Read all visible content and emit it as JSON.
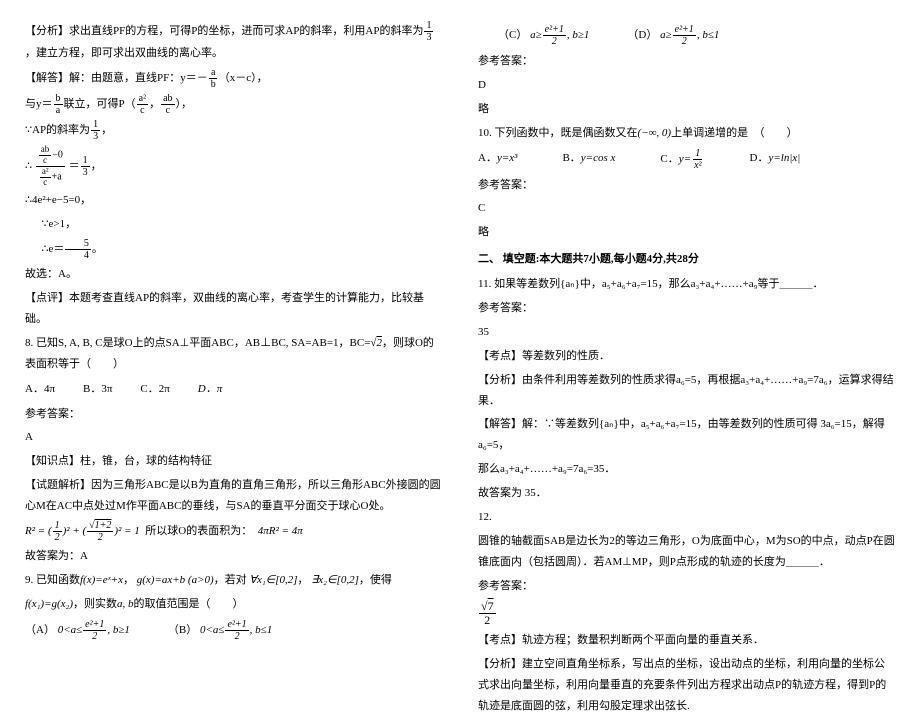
{
  "left": {
    "analysis1": "【分析】求出直线PF的方程，可得P的坐标，进而可求AP的斜率，利用AP的斜率为",
    "analysis1b": "，建立方程，即可求出双曲线的离心率。",
    "solve1": "【解答】解：由题意，直线PF：y＝－",
    "solve1b": "（x－c），",
    "line2a": "与y＝",
    "line2b": "联立，可得P（",
    "line2c": "，",
    "line2d": "），",
    "line3": "∵AP的斜率为",
    "line3b": "，",
    "line4a": "∴",
    "line4b": "＝",
    "line4c": "，",
    "line5": "∴4e²+e−5=0，",
    "line6": "∵e>1，",
    "line7a": "∴e＝",
    "line7b": "。",
    "line8": "故选：A。",
    "comment": "【点评】本题考查直线AP的斜率，双曲线的离心率，考查学生的计算能力，比较基础。",
    "q8": "8. 已知S, A, B, C是球O上的点SA⊥平面ABC，AB⊥BC, SA=AB=1，BC=",
    "q8b": "，则球O的表面积等于（　　）",
    "q8_optA": "A．4π",
    "q8_optB": "B．3π",
    "q8_optC": "C．2π",
    "q8_optD": "D．π",
    "ans8_label": "参考答案：",
    "ans8": "A",
    "kp8": "【知识点】柱，锥，台，球的结构特征",
    "exp8a": "【试题解析】因为三角形ABC是以B为直角的直角三角形，所以三角形ABC外接圆的圆心M在AC中点处过M作平面ABC的垂线，与SA的垂直平分面交于球心O处。",
    "exp8b": "所以球O的表面积为：",
    "exp8c": "故答案为：A",
    "q9a": "9. 已知函数",
    "q9b": "，",
    "q9c": "，若对",
    "q9d": "，",
    "q9e": "，使得",
    "q9f": "，则实数",
    "q9g": "的取值范围是（　　）",
    "q9_optA": "（A）",
    "q9_optB": "（B）"
  },
  "right": {
    "q9_optC": "（C）",
    "q9_optD": "（D）",
    "ans9_label": "参考答案：",
    "ans9": "D",
    "ans9_brief": "略",
    "q10": "10. 下列函数中，既是偶函数又在",
    "q10b": "上单调递增的是　（　　）",
    "q10_optA": "A．",
    "q10_optB": "B．",
    "q10_optC": "C．",
    "q10_optD": "D．",
    "ans10_label": "参考答案：",
    "ans10": "C",
    "ans10_brief": "略",
    "section2": "二、 填空题:本大题共7小题,每小题4分,共28分",
    "q11": "11. 如果等差数列{aₙ}中，a₅+a₆+a₇=15，那么a₃+a₄+……+a₉等于＿＿＿．",
    "ans11_label": "参考答案：",
    "ans11": "35",
    "kp11": "【考点】等差数列的性质．",
    "an11": "【分析】由条件利用等差数列的性质求得a₆=5，再根据a₃+a₄+……+a₉=7a₆，运算求得结果．",
    "sol11a": "【解答】解：∵等差数列{aₙ}中，a₅+a₆+a₇=15，由等差数列的性质可得 3a₆=15，解得a₆=5，",
    "sol11b": "那么a₃+a₄+……+a₉=7a₆=35．",
    "sol11c": "故答案为 35．",
    "q12num": "12.",
    "q12": "圆锥的轴截面SAB是边长为2的等边三角形，O为底面中心，M为SO的中点，动点P在圆锥底面内（包括圆周）．若AM⊥MP，则P点形成的轨迹的长度为＿＿＿．",
    "ans12_label": "参考答案：",
    "kp12": "【考点】轨迹方程；数量积判断两个平面向量的垂直关系．",
    "an12": "【分析】建立空间直角坐标系，写出点的坐标，设出动点的坐标，利用向量的坐标公式求出向量坐标，利用向量垂直的充要条件列出方程求出动点P的轨迹方程，得到P的轨迹是底面圆的弦，利用勾股定理求出弦长."
  }
}
